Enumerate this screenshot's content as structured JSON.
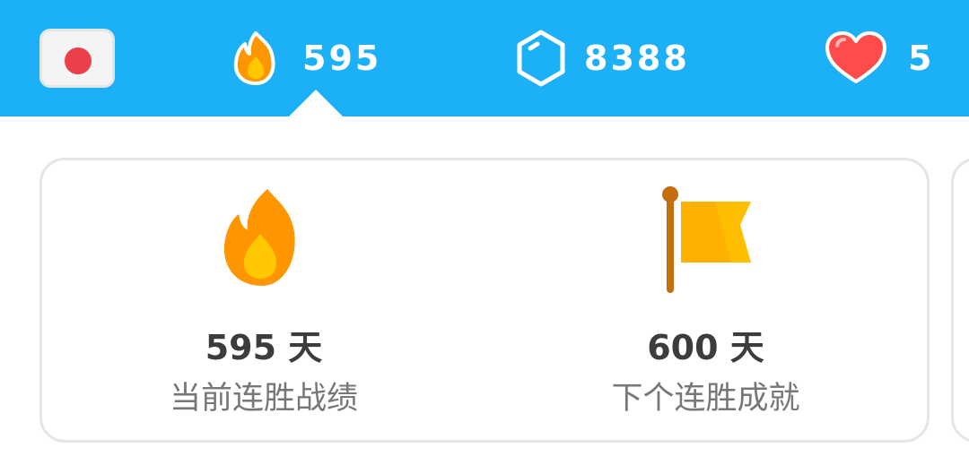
{
  "header": {
    "language_flag": "japanese-flag-icon",
    "streak": {
      "icon": "flame-icon",
      "count": "595"
    },
    "gems": {
      "icon": "gem-icon",
      "count": "8388"
    },
    "hearts": {
      "icon": "heart-icon",
      "count": "5"
    }
  },
  "cards": [
    {
      "icon": "flame-icon",
      "value": "595 天",
      "label": "当前连胜战绩"
    },
    {
      "icon": "flag-icon",
      "value": "600 天",
      "label": "下个连胜成就"
    }
  ],
  "colors": {
    "header_bg": "#1CB0F6",
    "flame_orange": "#FF9600",
    "flame_yellow": "#FFC800",
    "heart_red": "#FF4B4B",
    "flag_yellow": "#FFB100",
    "pole_brown": "#C46E10",
    "text_dark": "#3C3C3C",
    "text_gray": "#777777",
    "border_gray": "#E5E5E5"
  }
}
